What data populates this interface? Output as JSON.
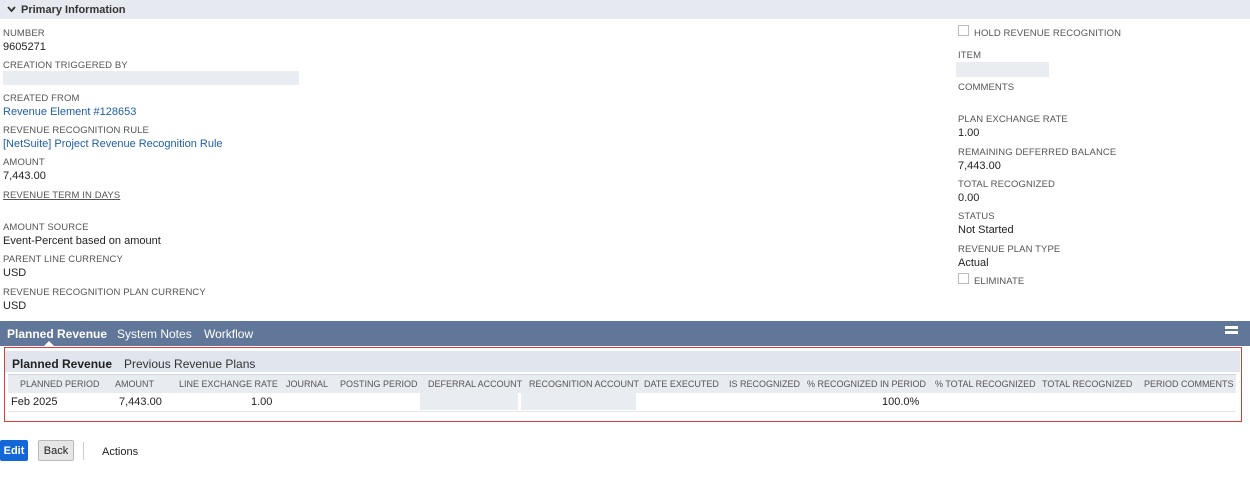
{
  "section": {
    "title": "Primary Information"
  },
  "left_fields": {
    "number": {
      "label": "NUMBER",
      "value": "9605271"
    },
    "creation_triggered_by": {
      "label": "CREATION TRIGGERED BY"
    },
    "created_from": {
      "label": "CREATED FROM",
      "value": "Revenue Element #128653"
    },
    "revenue_recognition_rule": {
      "label": "REVENUE RECOGNITION RULE",
      "value": "[NetSuite] Project Revenue Recognition Rule"
    },
    "amount": {
      "label": "AMOUNT",
      "value": "7,443.00"
    },
    "revenue_term_in_days": {
      "label": "REVENUE TERM IN DAYS"
    },
    "amount_source": {
      "label": "AMOUNT SOURCE",
      "value": "Event-Percent based on amount"
    },
    "parent_line_currency": {
      "label": "PARENT LINE CURRENCY",
      "value": "USD"
    },
    "plan_currency": {
      "label": "REVENUE RECOGNITION PLAN CURRENCY",
      "value": "USD"
    }
  },
  "right_fields": {
    "hold_revenue_recognition": {
      "label": "HOLD REVENUE RECOGNITION",
      "checked": false
    },
    "item": {
      "label": "ITEM"
    },
    "comments": {
      "label": "COMMENTS"
    },
    "plan_exchange_rate": {
      "label": "PLAN EXCHANGE RATE",
      "value": "1.00"
    },
    "remaining_deferred_balance": {
      "label": "REMAINING DEFERRED BALANCE",
      "value": "7,443.00"
    },
    "total_recognized": {
      "label": "TOTAL RECOGNIZED",
      "value": "0.00"
    },
    "status": {
      "label": "STATUS",
      "value": "Not Started"
    },
    "revenue_plan_type": {
      "label": "REVENUE PLAN TYPE",
      "value": "Actual"
    },
    "eliminate": {
      "label": "ELIMINATE",
      "checked": false
    }
  },
  "tabs": [
    "Planned Revenue",
    "System Notes",
    "Workflow"
  ],
  "subtabs": [
    "Planned Revenue",
    "•",
    "Previous Revenue Plans"
  ],
  "table": {
    "columns": [
      "PLANNED PERIOD",
      "AMOUNT",
      "LINE EXCHANGE RATE",
      "JOURNAL",
      "POSTING PERIOD",
      "DEFERRAL ACCOUNT",
      "RECOGNITION ACCOUNT",
      "DATE EXECUTED",
      "IS RECOGNIZED",
      "% RECOGNIZED IN PERIOD",
      "% TOTAL RECOGNIZED",
      "TOTAL RECOGNIZED",
      "PERIOD COMMENTS"
    ],
    "rows": [
      {
        "planned_period": "Feb 2025",
        "amount": "7,443.00",
        "line_exchange_rate": "1.00",
        "pct_recognized_in_period": "100.0%"
      }
    ]
  },
  "buttons": {
    "edit": "Edit",
    "back": "Back",
    "actions": "Actions"
  },
  "colors": {
    "tab_bar": "#607799",
    "primary_button": "#1467d6",
    "link": "#1f5ea8",
    "highlight_border": "#d93b3b"
  }
}
